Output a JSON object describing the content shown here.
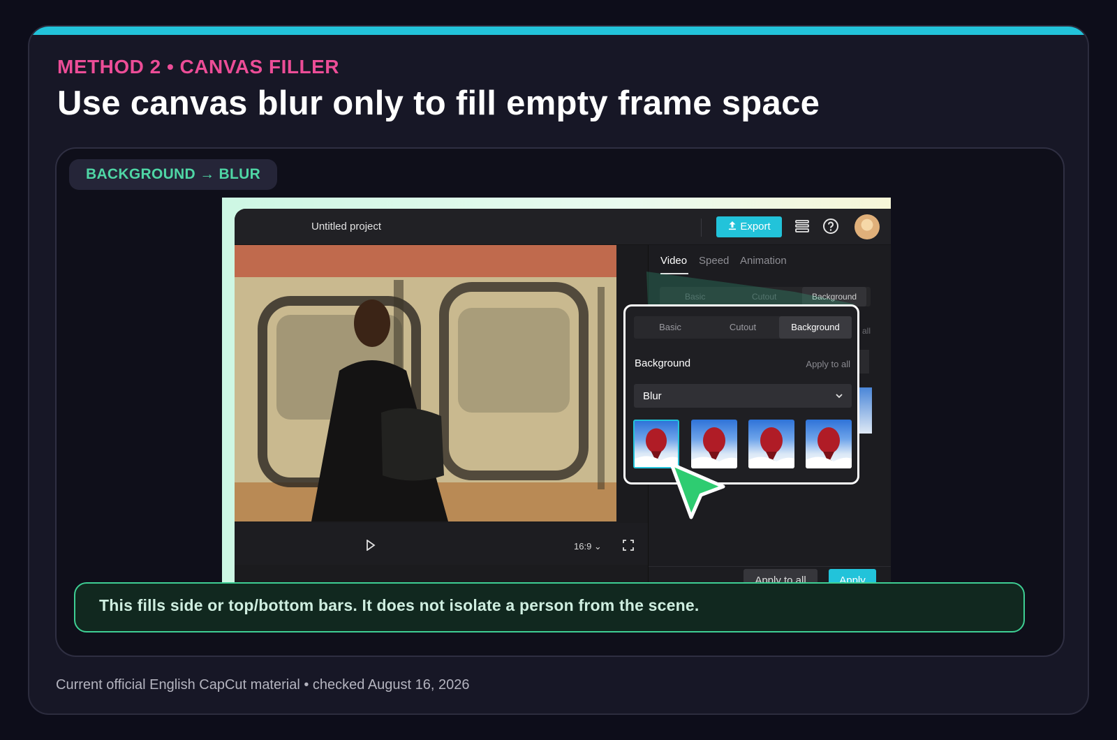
{
  "card": {
    "eyebrow": "METHOD 2 • CANVAS FILLER",
    "headline": "Use canvas blur only to fill empty frame space",
    "footer": "Current official English CapCut material • checked August 16, 2026"
  },
  "panel": {
    "pill": "BACKGROUND → BLUR",
    "callout": "This fills side or top/bottom bars. It does not isolate a person from the scene."
  },
  "app": {
    "project_title": "Untitled project",
    "export_label": "Export",
    "tabs": [
      {
        "label": "Video"
      },
      {
        "label": "Speed"
      },
      {
        "label": "Animation"
      }
    ],
    "ghost_segments": [
      {
        "label": "Basic"
      },
      {
        "label": "Cutout"
      },
      {
        "label": "Background"
      }
    ],
    "ghost_all": "all",
    "aspect_ratio": "16:9",
    "apply_to_all_button": "Apply to all",
    "apply_button": "Apply"
  },
  "zoom": {
    "segments": [
      {
        "label": "Basic"
      },
      {
        "label": "Cutout"
      },
      {
        "label": "Background"
      }
    ],
    "selected_segment": "Background",
    "section_label": "Background",
    "apply_to_all": "Apply to all",
    "select_value": "Blur",
    "blur_thumbnails": 4,
    "selected_thumbnail": 1
  },
  "colors": {
    "accent": "#22c3da",
    "eyebrow": "#ec4d97",
    "pill_text": "#4fd6a5",
    "callout_border": "#3ecf94",
    "cursor": "#2ecc71"
  },
  "icons": [
    "upload-icon",
    "layers-icon",
    "help-icon",
    "avatar",
    "play-icon",
    "chevron-down-icon",
    "fullscreen-icon",
    "cursor-icon"
  ]
}
